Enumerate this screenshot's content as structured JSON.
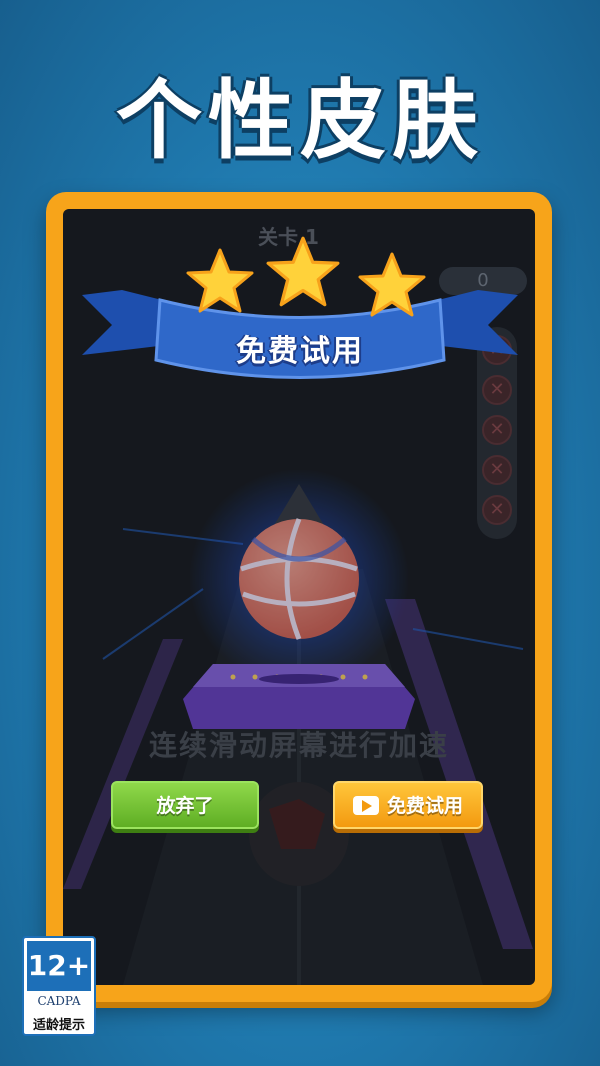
{
  "headline": "个性皮肤",
  "game": {
    "level_label": "关卡 1",
    "coin_count": "0",
    "hint_text": "连续滑动屏幕进行加速",
    "star_count": 3,
    "ribbon_text": "免费试用",
    "buttons": {
      "give_up": "放弃了",
      "free_trial": "免费试用"
    },
    "side_icons": [
      "close-icon",
      "close-icon",
      "close-icon",
      "close-icon",
      "close-icon"
    ]
  },
  "age_rating": {
    "age": "12+",
    "org": "CADPA",
    "tip": "适龄提示"
  },
  "colors": {
    "background": "#1f78ad",
    "frame": "#f7a41a",
    "ribbon": "#2f68c9",
    "star": "#ffd23a",
    "btn_green": "#6cbc2b",
    "btn_orange": "#f5a516",
    "ball": "#ef8a7e",
    "platform": "#7b5bd6"
  }
}
